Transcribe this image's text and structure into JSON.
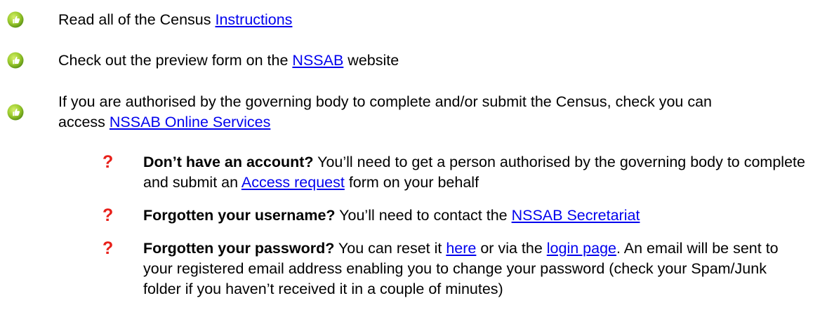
{
  "colors": {
    "link": "#0000ee",
    "question_mark": "#e8201a",
    "icon_green_light": "#b5dc3a",
    "icon_green_dark": "#6fa51b"
  },
  "icons": {
    "check": "thumbs-up-icon",
    "question": "question-mark-icon"
  },
  "checklist": [
    {
      "before": "Read all of the Census ",
      "link": "Instructions",
      "after": ""
    },
    {
      "before": "Check out the preview form on the ",
      "link": "NSSAB",
      "after": " website"
    },
    {
      "before": "If you are authorised by the governing body to complete and/or submit the Census, check you can access ",
      "link": "NSSAB Online Services",
      "after": ""
    }
  ],
  "questions": [
    {
      "mark": "?",
      "bold": "Don’t have an account?",
      "before": " You’ll need to get a person authorised by the governing body to complete and submit an ",
      "link": "Access request",
      "after": " form on your behalf"
    },
    {
      "mark": "?",
      "bold": "Forgotten your username?",
      "before": " You’ll need to contact the ",
      "link": "NSSAB Secretariat",
      "after": ""
    },
    {
      "mark": "?",
      "bold": "Forgotten your password?",
      "before": " You can reset it ",
      "link": "here",
      "middle": " or via the ",
      "link2": "login page",
      "after": ". An email will be sent to your registered email address enabling you to change your password (check your Spam/Junk folder if you haven’t received it in a couple of minutes)"
    }
  ]
}
